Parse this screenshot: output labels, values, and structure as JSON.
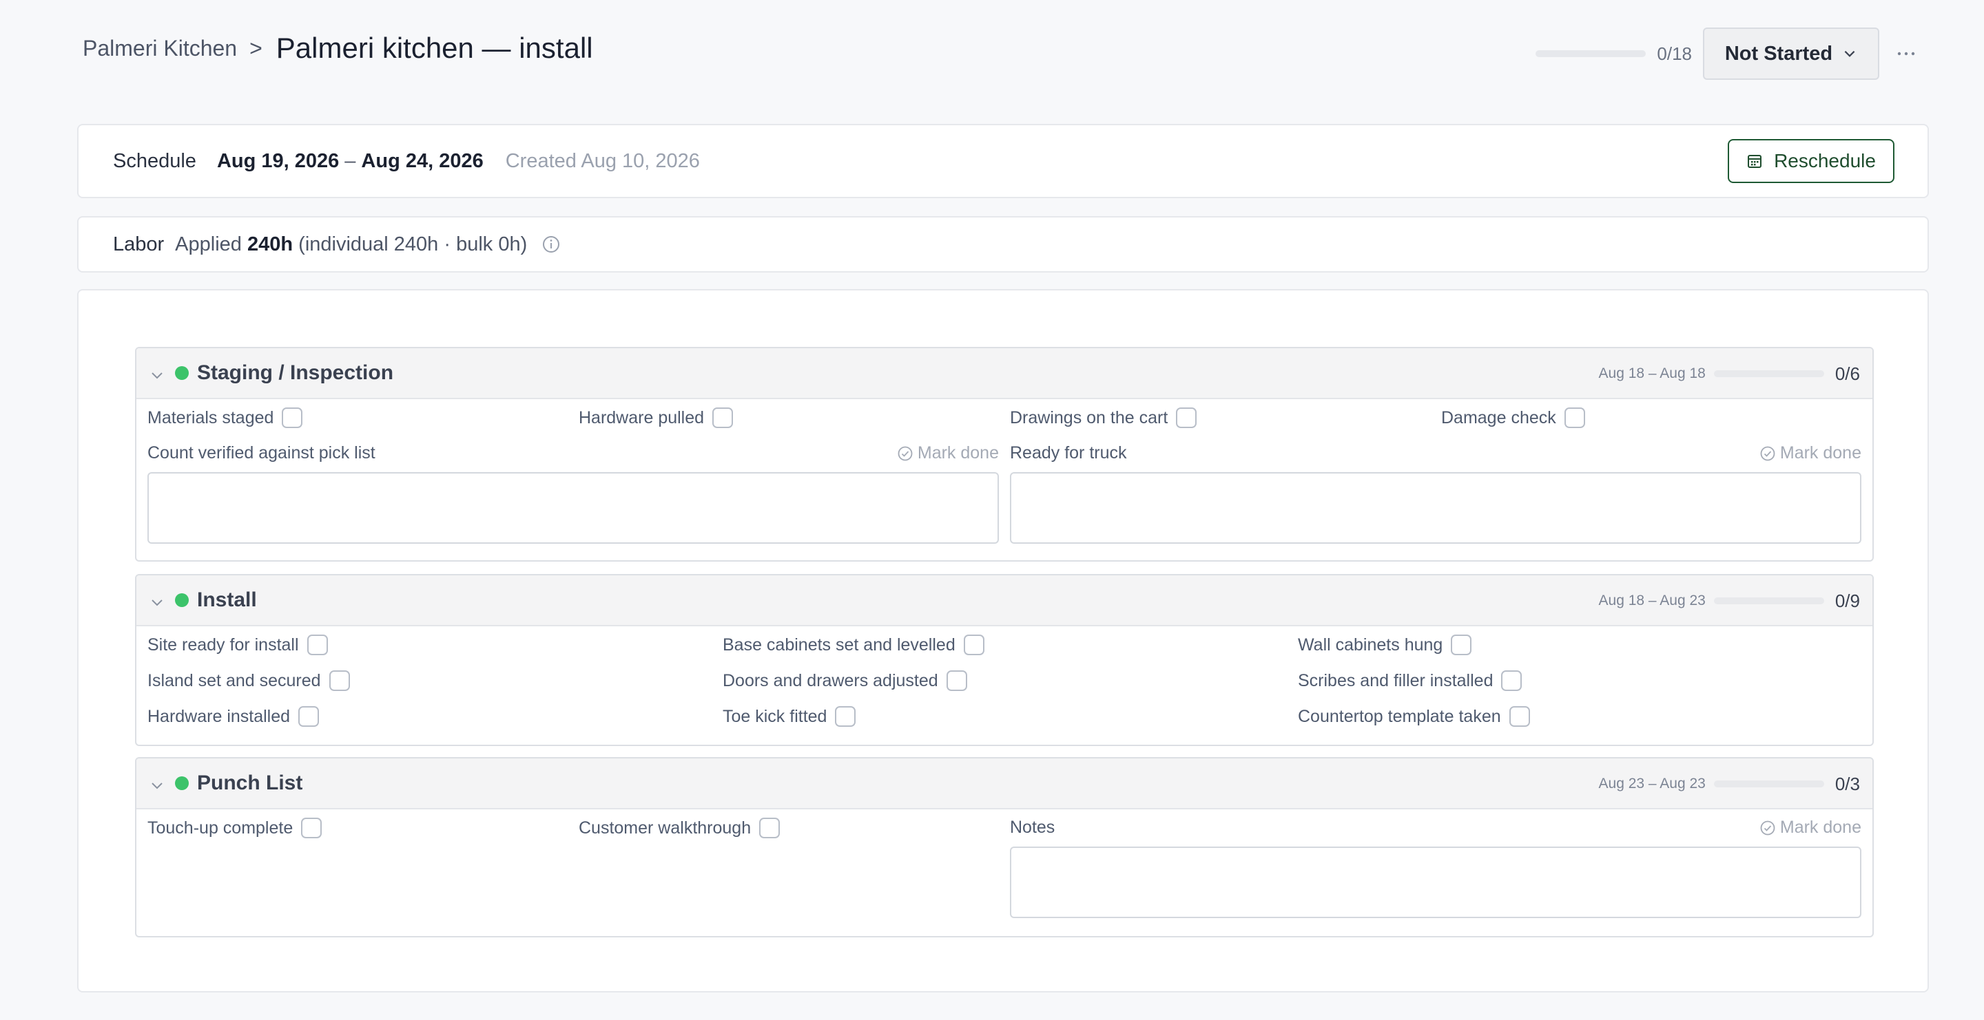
{
  "header": {
    "breadcrumb_root": "Palmeri Kitchen",
    "breadcrumb_sep": ">",
    "title": "Palmeri kitchen — install",
    "progress": {
      "done": 0,
      "total": 18,
      "label": "0/18"
    },
    "status": "Not Started",
    "more_icon": "ellipsis-icon"
  },
  "schedule": {
    "label": "Schedule",
    "start": "Aug 19, 2026",
    "dash": "–",
    "end": "Aug 24, 2026",
    "created": "Created Aug 10, 2026",
    "reschedule_label": "Reschedule"
  },
  "labor": {
    "label": "Labor",
    "prefix": "Applied",
    "hours": "240h",
    "detail": "(individual 240h · bulk 0h)"
  },
  "mark_done_label": "Mark done",
  "sections": [
    {
      "title": "Staging / Inspection",
      "dates": "Aug 18 – Aug 18",
      "done": 0,
      "total": 6,
      "count": "0/6",
      "tasks": [
        "Materials staged",
        "Hardware pulled",
        "Drawings on the cart",
        "Damage check"
      ],
      "notes": [
        "Count verified against pick list",
        "Ready for truck"
      ]
    },
    {
      "title": "Install",
      "dates": "Aug 18 – Aug 23",
      "done": 0,
      "total": 9,
      "count": "0/9",
      "tasks": [
        "Site ready for install",
        "Base cabinets set and levelled",
        "Wall cabinets hung",
        "Island set and secured",
        "Doors and drawers adjusted",
        "Scribes and filler installed",
        "Hardware installed",
        "Toe kick fitted",
        "Countertop template taken"
      ],
      "notes": []
    },
    {
      "title": "Punch List",
      "dates": "Aug 23 – Aug 23",
      "done": 0,
      "total": 3,
      "count": "0/3",
      "tasks": [
        "Touch-up complete",
        "Customer walkthrough"
      ],
      "notes": [
        "Notes"
      ]
    }
  ],
  "colors": {
    "accent_green": "#3cc36a",
    "reschedule_border": "#1f5a34"
  }
}
